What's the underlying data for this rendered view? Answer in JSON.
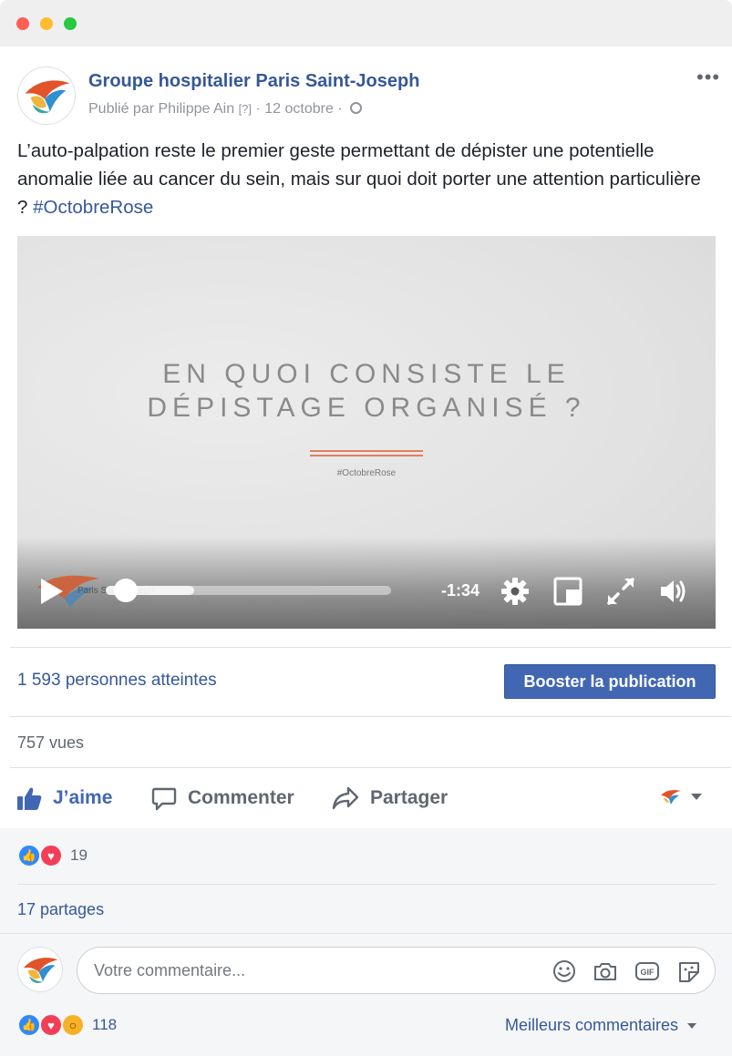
{
  "post": {
    "page_name": "Groupe hospitalier Paris Saint-Joseph",
    "published_by": "Publié par Philippe Ain",
    "help_marker": "[?]",
    "date": "12 octobre",
    "separator": "·",
    "more_label": "•••",
    "text": "L’auto-palpation reste le premier geste permettant de dépister une potentielle anomalie liée au cancer du sein, mais sur quoi doit porter une attention particulière ?",
    "hashtag": "#OctobreRose"
  },
  "video": {
    "title_line1": "EN QUOI CONSISTE LE",
    "title_line2": "DÉPISTAGE ORGANISÉ ?",
    "tag": "#OctobreRose",
    "watermark": "Paris Saint-Joseph",
    "time_remaining": "-1:34",
    "progress_fraction": 0.03,
    "buffered_fraction": 0.31
  },
  "insights": {
    "reached": "1 593 personnes atteintes",
    "boost_label": "Booster la publication",
    "views": "757 vues"
  },
  "actions": {
    "like": "J’aime",
    "comment": "Commenter",
    "share": "Partager"
  },
  "reactions": {
    "count": "19",
    "shares": "17 partages"
  },
  "comment": {
    "placeholder": "Votre commentaire...",
    "bottom_count": "118",
    "sort_label": "Meilleurs commentaires"
  },
  "colors": {
    "brand_blue": "#4267b2",
    "link_blue": "#365899",
    "like_blue": "#2e89ff",
    "love_red": "#f33e58",
    "wow_yellow": "#f7b125"
  }
}
